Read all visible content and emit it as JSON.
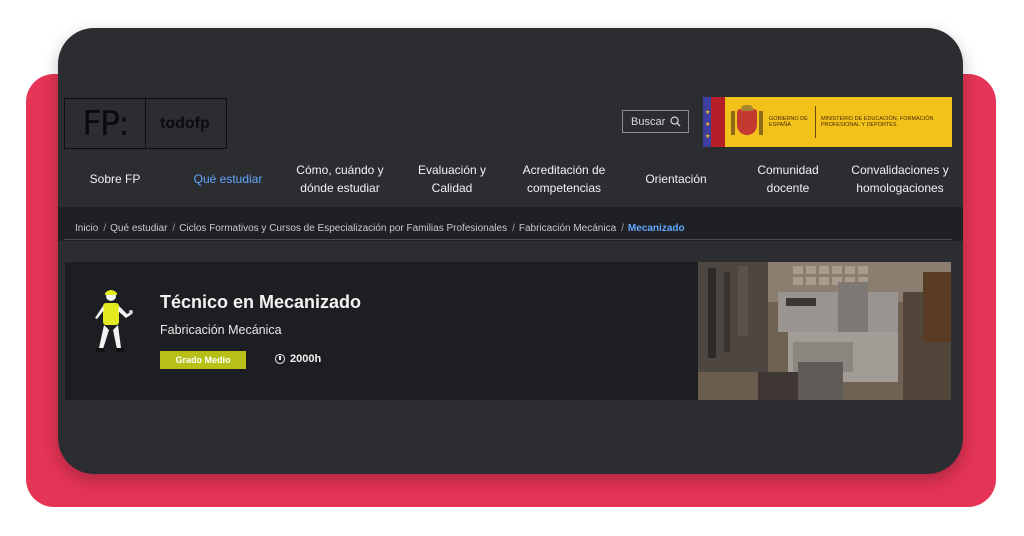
{
  "logo": {
    "mark": "FP:",
    "name": "todofp"
  },
  "search": {
    "label": "Buscar",
    "icon": "search-icon"
  },
  "gov": {
    "left_text": "GOBIERNO DE ESPAÑA",
    "right_text": "MINISTERIO DE EDUCACIÓN, FORMACIÓN PROFESIONAL Y DEPORTES",
    "color": "#f3c21a"
  },
  "nav": {
    "items": [
      {
        "label": "Sobre FP"
      },
      {
        "label": "Qué estudiar",
        "active": true
      },
      {
        "label_1": "Cómo, cuándo y",
        "label_2": "dónde estudiar"
      },
      {
        "label_1": "Evaluación y",
        "label_2": "Calidad"
      },
      {
        "label_1": "Acreditación de",
        "label_2": "competencias"
      },
      {
        "label": "Orientación"
      },
      {
        "label_1": "Comunidad",
        "label_2": "docente"
      },
      {
        "label_1": "Convalidaciones y",
        "label_2": "homologaciones"
      }
    ],
    "active_color": "#62a7ff"
  },
  "breadcrumb": {
    "items": [
      "Inicio",
      "Qué estudiar",
      "Ciclos Formativos y Cursos de Especialización por Familias Profesionales",
      "Fabricación Mecánica"
    ],
    "current": "Mecanizado",
    "separator": "/"
  },
  "course": {
    "title": "Técnico en Mecanizado",
    "family": "Fabricación Mecánica",
    "level": "Grado Medio",
    "hours": "2000h",
    "badge_color": "#b8c018",
    "icon": "worker-figure-icon",
    "photo": "machining-workshop-image"
  },
  "colors": {
    "red_background": "#e53455",
    "window_background": "#2b2d31",
    "card_background": "#1d1e21"
  }
}
